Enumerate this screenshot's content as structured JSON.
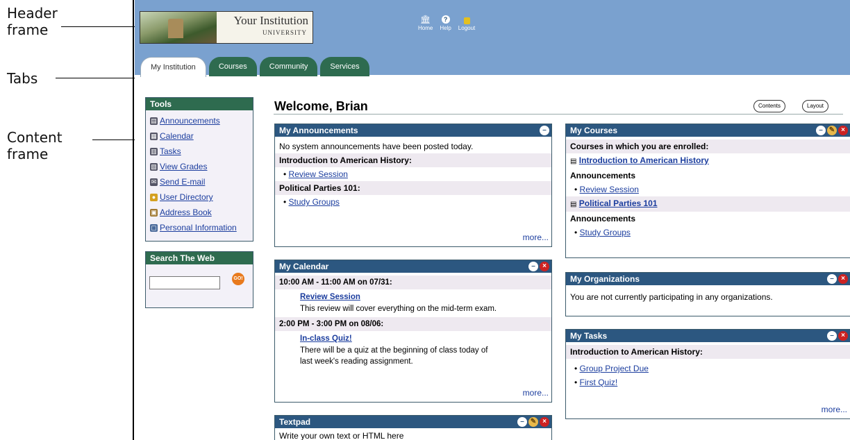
{
  "annotations": {
    "header_frame_line1": "Header",
    "header_frame_line2": "frame",
    "tabs": "Tabs",
    "content_frame_line1": "Content",
    "content_frame_line2": "frame"
  },
  "header": {
    "banner_name": "Your Institution",
    "banner_university": "UNIVERSITY",
    "nav": [
      {
        "label": "Home",
        "icon": "home-icon"
      },
      {
        "label": "Help",
        "icon": "help-icon"
      },
      {
        "label": "Logout",
        "icon": "lock-icon"
      }
    ]
  },
  "tabs": [
    "My Institution",
    "Courses",
    "Community",
    "Services"
  ],
  "tools": {
    "title": "Tools",
    "items": [
      "Announcements",
      "Calendar",
      "Tasks",
      "View Grades",
      "Send E-mail",
      "User Directory",
      "Address Book",
      "Personal Information"
    ]
  },
  "search": {
    "title": "Search The Web",
    "go_label": "GO!"
  },
  "welcome": "Welcome, Brian",
  "buttons": {
    "contents": "Contents",
    "layout": "Layout"
  },
  "announcements": {
    "title": "My Announcements",
    "system": "No system announcements have been posted today.",
    "course1": "Introduction to American History:",
    "course1_item": "Review Session",
    "course2": "Political Parties 101:",
    "course2_item": "Study Groups",
    "more": "more..."
  },
  "calendar": {
    "title": "My Calendar",
    "event1_time": "10:00 AM - 11:00 AM on 07/31:",
    "event1_title": "Review Session",
    "event1_desc": "This review will cover everything on the mid-term exam.",
    "event2_time": "2:00 PM - 3:00 PM on 08/06:",
    "event2_title": "In-class Quiz!",
    "event2_desc1": "There will be a quiz at the beginning of class today of",
    "event2_desc2": "last week's reading assignment.",
    "more": "more..."
  },
  "textpad": {
    "title": "Textpad",
    "text": "Write your own text or HTML here"
  },
  "courses": {
    "title": "My Courses",
    "enrolled": "Courses in which you are enrolled:",
    "course1": "Introduction to American History",
    "ann1_label": "Announcements",
    "ann1_item": "Review Session",
    "course2": "Political Parties 101",
    "ann2_label": "Announcements",
    "ann2_item": "Study Groups"
  },
  "organizations": {
    "title": "My Organizations",
    "text": "You are not currently participating in any organizations."
  },
  "tasks": {
    "title": "My Tasks",
    "course": "Introduction to American History:",
    "items": [
      "Group Project Due",
      "First Quiz!"
    ],
    "more": "more..."
  }
}
